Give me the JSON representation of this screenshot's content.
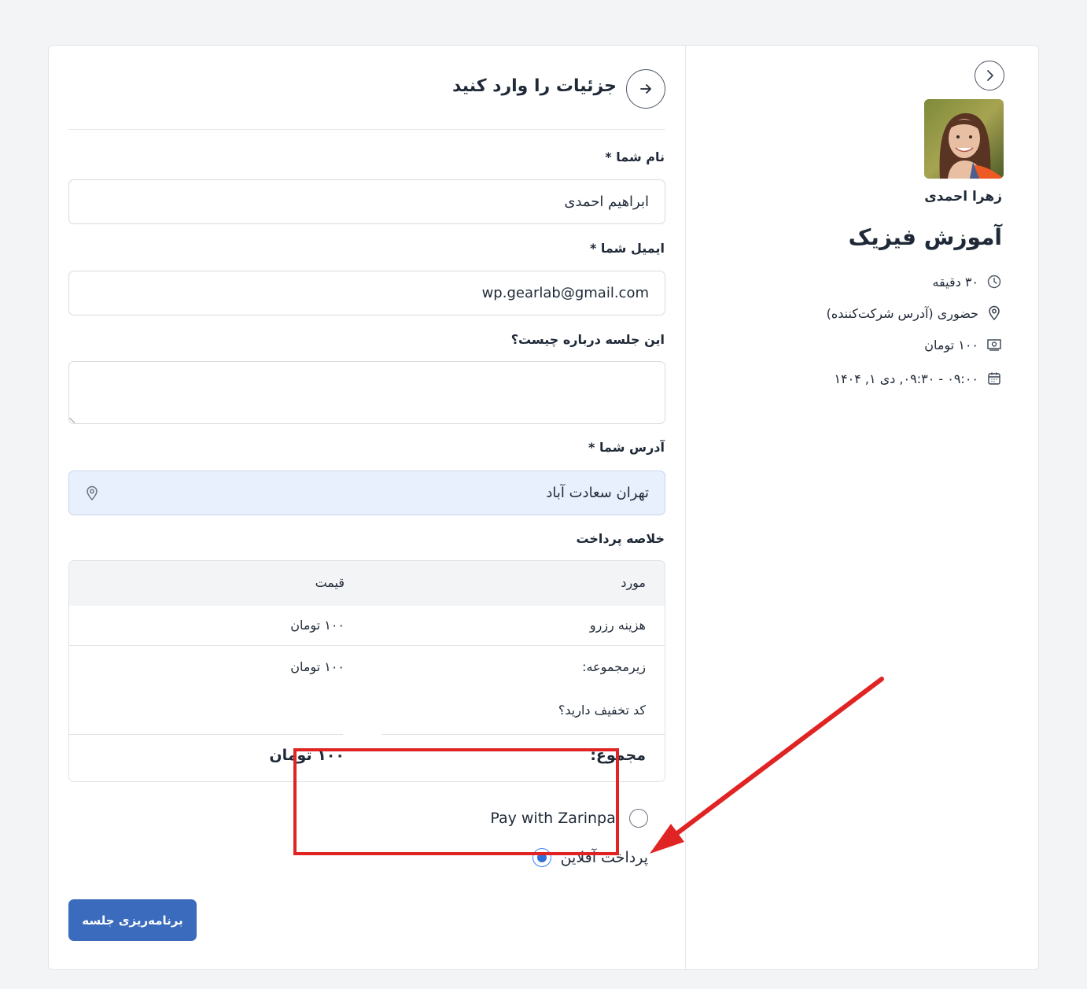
{
  "summary": {
    "host_name": "زهرا احمدی",
    "event_title": "آموزش فیزیک",
    "duration": "۳۰ دقیقه",
    "location": "حضوری (آدرس شرکت‌کننده)",
    "price": "۱۰۰ تومان",
    "datetime": "۰۹:۰۰ - ۰۹:۳۰, دی ۱, ۱۴۰۴",
    "icons": [
      "chevron-right-icon",
      "clock-icon",
      "map-pin-icon",
      "money-icon",
      "calendar-icon"
    ]
  },
  "form": {
    "title": "جزئیات را وارد کنید",
    "name_label": "نام شما *",
    "name_value": "ابراهیم احمدی",
    "email_label": "ایمیل شما *",
    "email_value": "wp.gearlab@gmail.com",
    "notes_label": "این جلسه درباره چیست؟",
    "address_label": "آدرس شما *",
    "address_value": "تهران سعادت آباد"
  },
  "payment": {
    "title": "خلاصه پرداخت",
    "headers": {
      "item": "مورد",
      "price": "قیمت"
    },
    "rows": [
      {
        "item": "هزینه رزرو",
        "price": "۱۰۰ تومان"
      },
      {
        "item": "زیرمجموعه:",
        "price": "۱۰۰ تومان"
      }
    ],
    "coupon": "کد تخفیف دارید؟",
    "total_label": "مجموع:",
    "total_value": "۱۰۰ تومان",
    "methods": [
      {
        "label": "Pay with Zarinpal",
        "checked": false
      },
      {
        "label": "پرداخت آفلاین",
        "checked": true
      }
    ]
  },
  "submit_label": "برنامه‌ریزی جلسه",
  "colors": {
    "accent": "#3a6bbd",
    "highlight_box": "#e02424",
    "address_bg": "#e8f0fe"
  }
}
